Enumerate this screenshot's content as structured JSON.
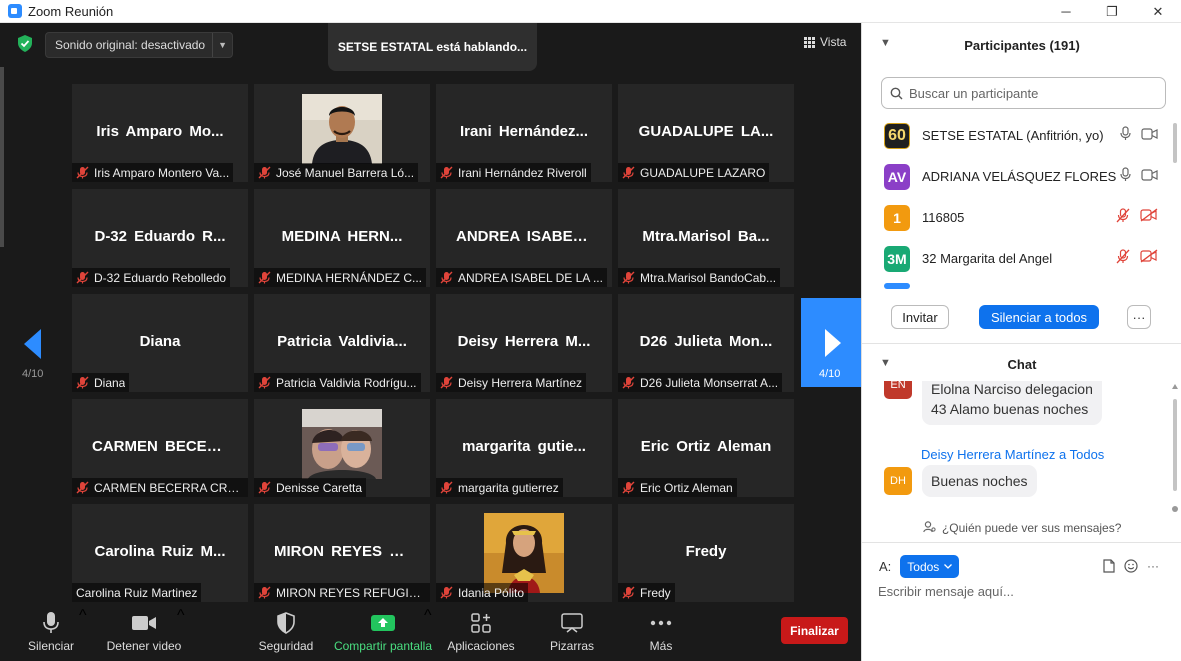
{
  "window": {
    "title": "Zoom Reunión",
    "minimize": "─",
    "restore": "❐",
    "close": "✕"
  },
  "top": {
    "sound": "Sonido original: desactivado",
    "speaking": "SETSE ESTATAL está hablando...",
    "view": "Vista"
  },
  "nav": {
    "left_page": "4/10",
    "right_page": "4/10"
  },
  "tiles": [
    {
      "big": "Iris Amparo Mo...",
      "label": "Iris Amparo Montero Va...",
      "muted": true,
      "photo": ""
    },
    {
      "big": "",
      "label": "José Manuel Barrera Ló...",
      "muted": true,
      "photo": "man"
    },
    {
      "big": "Irani Hernández...",
      "label": "Irani Hernández Riveroll",
      "muted": true,
      "photo": ""
    },
    {
      "big": "GUADALUPE LA...",
      "label": "GUADALUPE LAZARO",
      "muted": true,
      "photo": ""
    },
    {
      "big": "D-32 Eduardo R...",
      "label": "D-32 Eduardo Rebolledo",
      "muted": true,
      "photo": ""
    },
    {
      "big": "MEDINA HERN...",
      "label": "MEDINA HERNÁNDEZ C...",
      "muted": true,
      "photo": ""
    },
    {
      "big": "ANDREA ISABEL...",
      "label": "ANDREA ISABEL DE LA ...",
      "muted": true,
      "photo": ""
    },
    {
      "big": "Mtra.Marisol Ba...",
      "label": "Mtra.Marisol BandoCab...",
      "muted": true,
      "photo": ""
    },
    {
      "big": "Diana",
      "label": "Diana",
      "muted": true,
      "photo": ""
    },
    {
      "big": "Patricia Valdivia...",
      "label": "Patricia Valdivia Rodrígu...",
      "muted": true,
      "photo": ""
    },
    {
      "big": "Deisy Herrera M...",
      "label": "Deisy Herrera Martínez",
      "muted": true,
      "photo": ""
    },
    {
      "big": "D26 Julieta Mon...",
      "label": "D26 Julieta Monserrat A...",
      "muted": true,
      "photo": ""
    },
    {
      "big": "CARMEN BECER...",
      "label": "CARMEN BECERRA CRU...",
      "muted": true,
      "photo": ""
    },
    {
      "big": "",
      "label": "Denisse Caretta",
      "muted": true,
      "photo": "kids"
    },
    {
      "big": "margarita gutie...",
      "label": "margarita gutierrez",
      "muted": true,
      "photo": ""
    },
    {
      "big": "Eric Ortiz Aleman",
      "label": "Eric Ortiz Aleman",
      "muted": true,
      "photo": ""
    },
    {
      "big": "Carolina Ruiz M...",
      "label": "Carolina Ruiz Martinez",
      "muted": false,
      "photo": ""
    },
    {
      "big": "MIRON REYES R...",
      "label": "MIRON REYES REFUGIO...",
      "muted": true,
      "photo": ""
    },
    {
      "big": "",
      "label": "Idania Pólito",
      "muted": true,
      "photo": "woman"
    },
    {
      "big": "Fredy",
      "label": "Fredy",
      "muted": true,
      "photo": ""
    }
  ],
  "toolbar": {
    "mute": "Silenciar",
    "video": "Detener video",
    "security": "Seguridad",
    "share": "Compartir pantalla",
    "apps": "Aplicaciones",
    "whiteboards": "Pizarras",
    "more": "Más",
    "end": "Finalizar",
    "caret": "^"
  },
  "participants": {
    "title": "Participantes (191)",
    "search_placeholder": "Buscar un participante",
    "list": [
      {
        "avatar": "60",
        "name": "SETSE ESTATAL (Anfitrión, yo)",
        "color": "#1f1f1f",
        "muted": false
      },
      {
        "avatar": "AV",
        "name": "ADRIANA VELÁSQUEZ FLORES",
        "color": "#8b3fc7",
        "muted": false
      },
      {
        "avatar": "1",
        "name": "116805",
        "color": "#f29a0f",
        "muted": true
      },
      {
        "avatar": "3M",
        "name": "32 Margarita del Angel",
        "color": "#19a974",
        "muted": true
      }
    ],
    "invite": "Invitar",
    "mute_all": "Silenciar a todos",
    "more": "···"
  },
  "chat": {
    "title": "Chat",
    "messages": [
      {
        "avatar": "EN",
        "color": "#c0392b",
        "sender": "",
        "to": "",
        "text1": "Elolna Narciso delegacion",
        "text2": "43 Alamo buenas noches"
      },
      {
        "avatar": "DH",
        "color": "#f29a0f",
        "sender": "Deisy Herrera Martínez",
        "to": "a Todos",
        "text1": "Buenas noches",
        "text2": ""
      }
    ],
    "who": "¿Quién puede ver sus mensajes?",
    "to_label": "A:",
    "to_value": "Todos",
    "more": "···",
    "input_placeholder": "Escribir mensaje aquí..."
  },
  "colors": {
    "accent": "#2d8cff",
    "end": "#c81919",
    "share": "#22c55e",
    "muted_red": "#e0443a"
  }
}
